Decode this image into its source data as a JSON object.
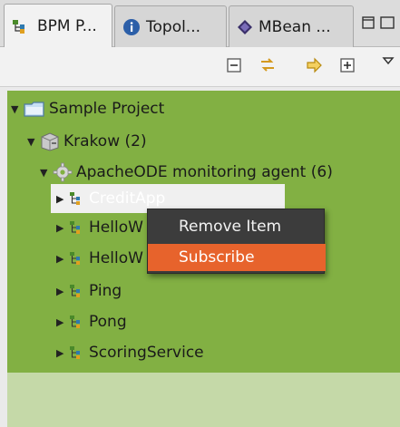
{
  "tabs": [
    {
      "label": "BPM P...",
      "icon": "bpm-process-icon",
      "active": true
    },
    {
      "label": "Topol...",
      "icon": "info-icon",
      "active": false
    },
    {
      "label": "MBean ...",
      "icon": "mbean-icon",
      "active": false
    }
  ],
  "toolbar": {
    "buttons": [
      "collapse-all-icon",
      "link-with-editor-icon",
      "forward-icon",
      "expand-all-icon",
      "view-menu-icon"
    ]
  },
  "tree": {
    "project": {
      "label": "Sample Project",
      "icon": "folder-icon"
    },
    "host": {
      "label": "Krakow (2)",
      "icon": "server-icon"
    },
    "agent": {
      "label": "ApacheODE monitoring agent (6)",
      "icon": "gear-icon"
    },
    "processes": [
      {
        "label": "CreditApp"
      },
      {
        "label": "HelloW"
      },
      {
        "label": "HelloW"
      },
      {
        "label": "Ping"
      },
      {
        "label": "Pong"
      },
      {
        "label": "ScoringService"
      }
    ]
  },
  "context_menu": {
    "items": [
      {
        "label": "Remove Item",
        "highlighted": false
      },
      {
        "label": "Subscribe",
        "highlighted": true
      }
    ]
  },
  "colors": {
    "tree_bg": "#82b043",
    "menu_bg": "#3c3c3c",
    "menu_highlight": "#e7632c"
  }
}
